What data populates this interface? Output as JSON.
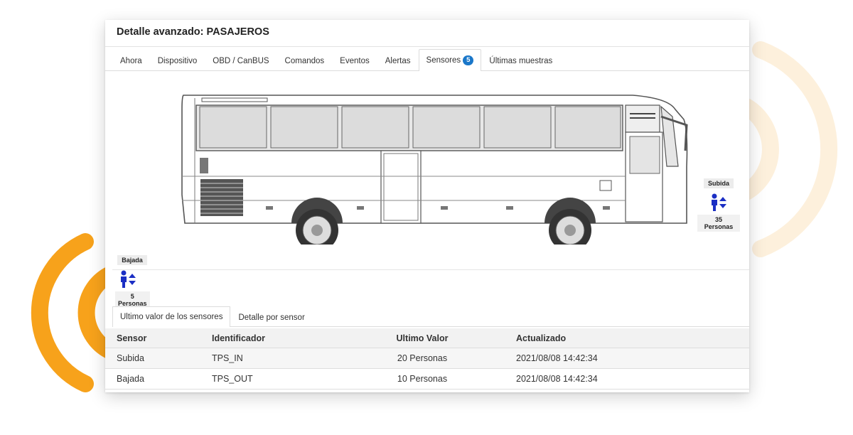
{
  "panel": {
    "title": "Detalle avanzado: PASAJEROS"
  },
  "tabs": [
    {
      "label": "Ahora"
    },
    {
      "label": "Dispositivo"
    },
    {
      "label": "OBD / CanBUS"
    },
    {
      "label": "Comandos"
    },
    {
      "label": "Eventos"
    },
    {
      "label": "Alertas"
    },
    {
      "label": "Sensores",
      "badge": "5",
      "active": true
    },
    {
      "label": "Últimas muestras"
    }
  ],
  "sensors_visual": {
    "subida": {
      "label": "Subida",
      "count": "35 Personas"
    },
    "bajada": {
      "label": "Bajada",
      "count": "5 Personas"
    }
  },
  "subtabs": [
    {
      "label": "Ultimo valor de los sensores",
      "active": true
    },
    {
      "label": "Detalle por sensor"
    }
  ],
  "table": {
    "headers": [
      "Sensor",
      "Identificador",
      "Ultimo Valor",
      "Actualizado"
    ],
    "rows": [
      [
        "Subida",
        "TPS_IN",
        "20 Personas",
        "2021/08/08 14:42:34"
      ],
      [
        "Bajada",
        "TPS_OUT",
        "10 Personas",
        "2021/08/08 14:42:34"
      ]
    ]
  },
  "colors": {
    "accent": "#1a77c9",
    "arc_orange": "#f7a21b",
    "arc_light": "#fdf0dc",
    "icon_blue": "#1b2fc4"
  }
}
